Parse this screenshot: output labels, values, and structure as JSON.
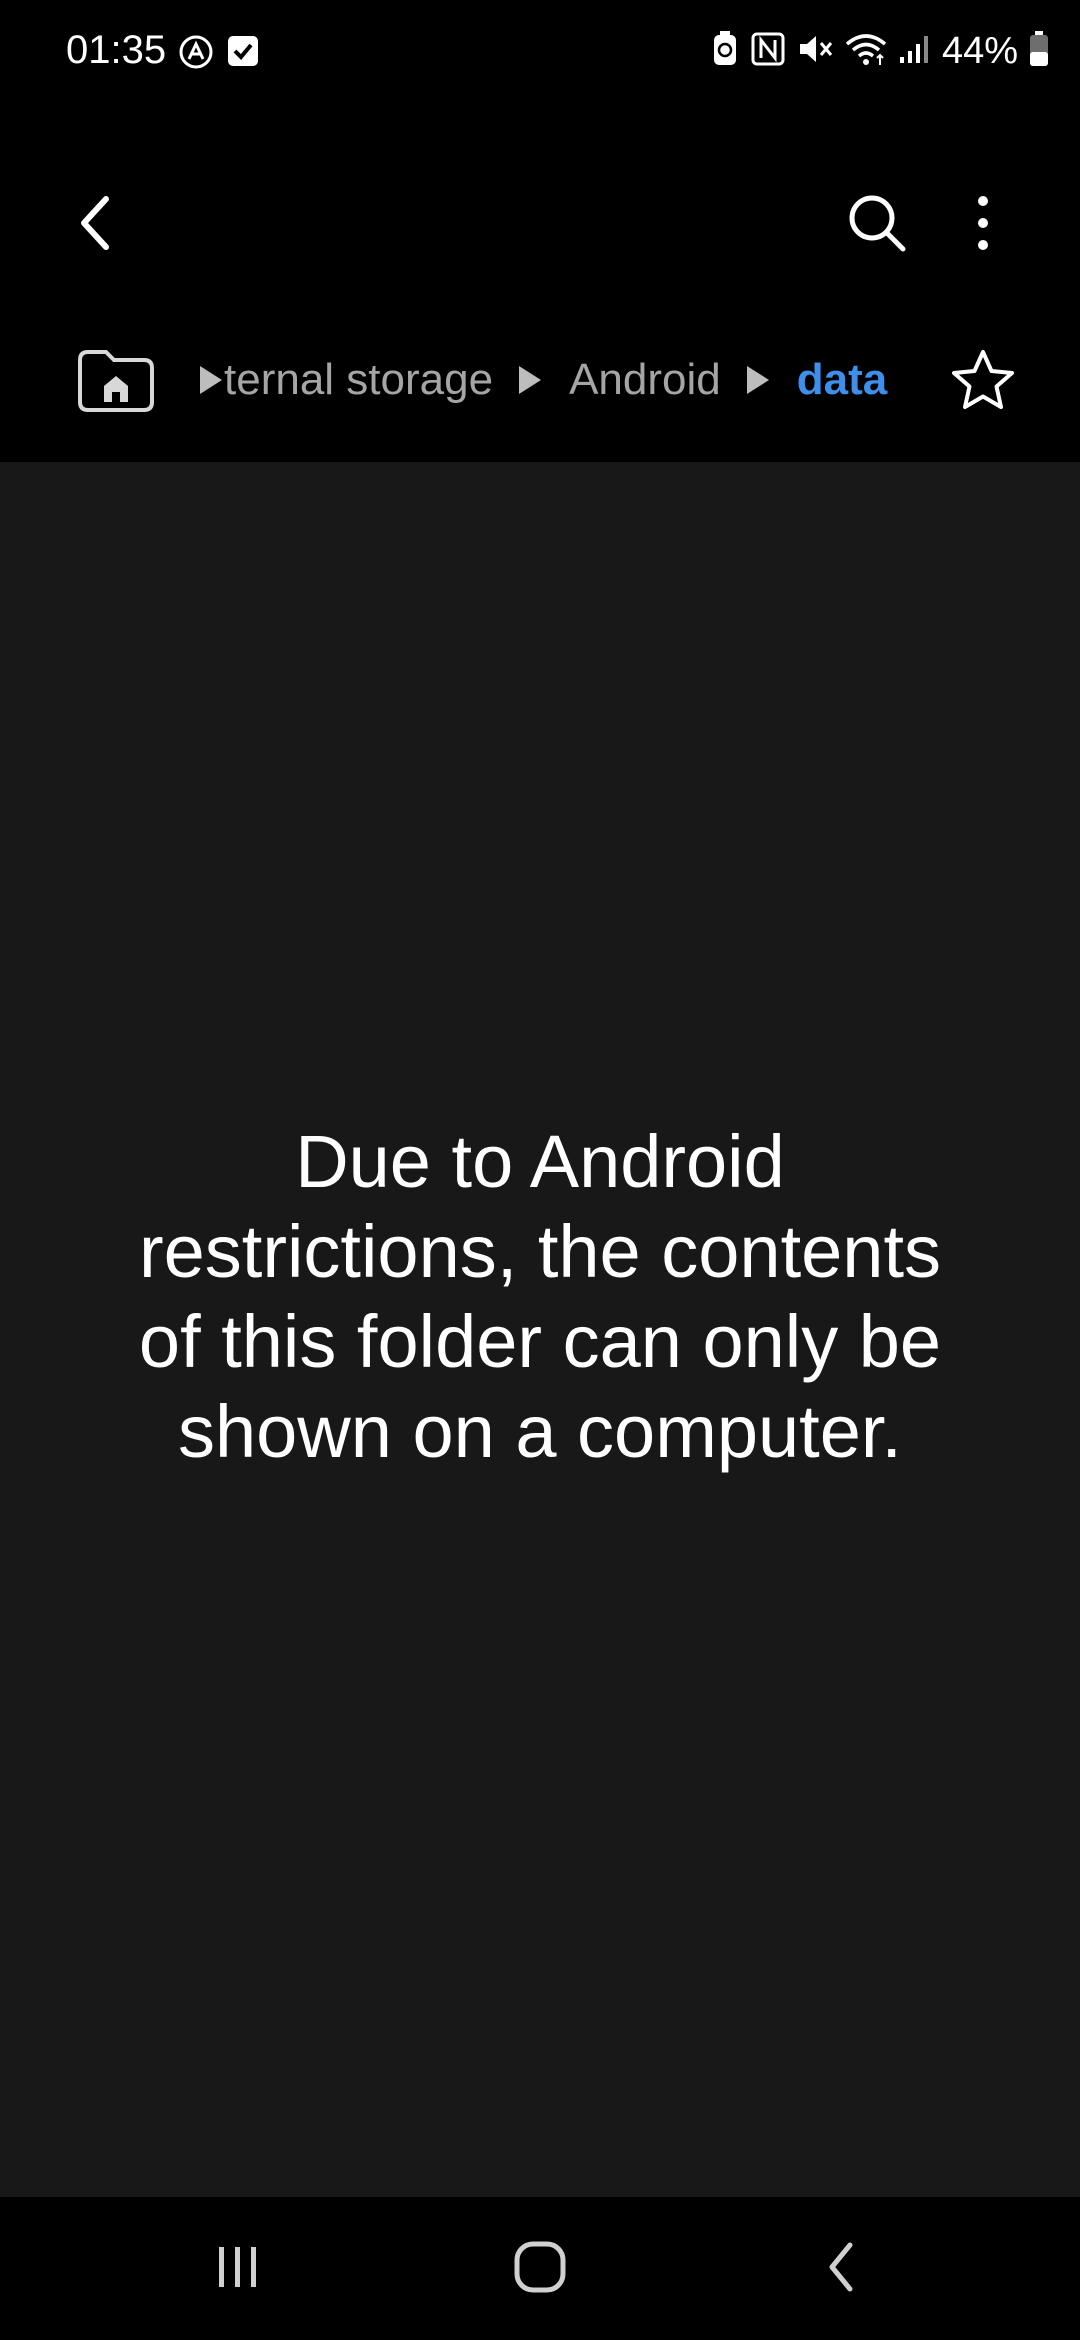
{
  "status_bar": {
    "time": "01:35",
    "battery_percent": "44%",
    "left_icons": [
      "auto-icon",
      "check-box-icon"
    ],
    "right_icons": [
      "battery-saver-icon",
      "nfc-icon",
      "mute-icon",
      "wifi-icon",
      "signal-icon",
      "battery-icon"
    ]
  },
  "app_bar": {
    "back_icon": "chevron-left-icon",
    "search_icon": "search-icon",
    "more_icon": "more-vertical-icon"
  },
  "breadcrumb": {
    "home_icon": "home-folder-icon",
    "items": [
      {
        "label": "ternal storage"
      },
      {
        "label": "Android"
      },
      {
        "label": "data"
      }
    ],
    "favorite_icon": "star-icon",
    "active_color": "#3e8fec"
  },
  "content": {
    "message": "Due to Android restrictions, the contents of this folder can only be shown on a computer."
  },
  "nav_bar": {
    "recents_icon": "recents-icon",
    "home_icon": "home-icon",
    "back_icon": "back-icon"
  }
}
